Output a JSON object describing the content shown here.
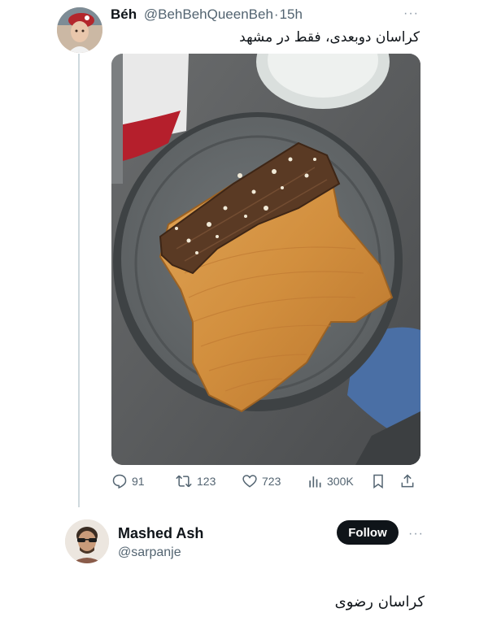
{
  "tweet": {
    "author_name": "Béh",
    "author_handle": "@BehBehQueenBeh",
    "separator": "·",
    "time": "15h",
    "more": "···",
    "text": "کراسان دوبعدی، فقط در مشهد",
    "stats": {
      "replies": "91",
      "retweets": "123",
      "likes": "723",
      "views": "300K"
    },
    "icons": {
      "reply": "reply-icon",
      "retweet": "retweet-icon",
      "like": "heart-icon",
      "views": "views-icon",
      "bookmark": "bookmark-icon",
      "share": "share-icon"
    }
  },
  "reply": {
    "author_name": "Mashed Ash",
    "author_handle": "@sarpanje",
    "follow_label": "Follow",
    "more": "···",
    "text": "کراسان رضوی"
  },
  "colors": {
    "text": "#0f1419",
    "muted": "#536471",
    "thread_line": "#cfd9de",
    "follow_bg": "#0f1419"
  }
}
